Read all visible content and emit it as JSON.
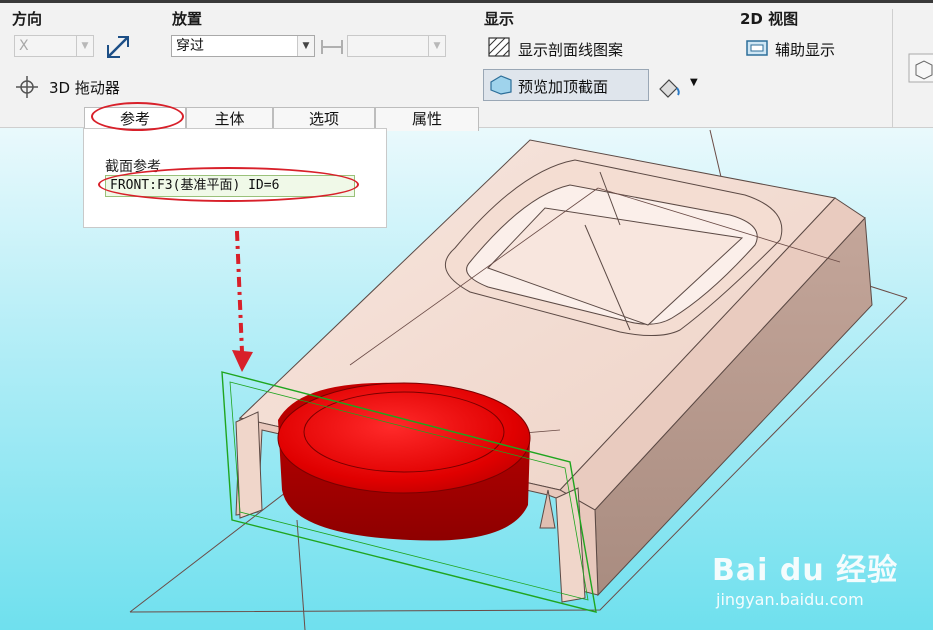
{
  "ribbon": {
    "direction": {
      "title": "方向",
      "axis_value": "X",
      "dragger_label": "3D 拖动器"
    },
    "placement": {
      "title": "放置",
      "mode_value": "穿过",
      "offset_value": ""
    },
    "display": {
      "title": "显示",
      "hatch_label": "显示剖面线图案",
      "preview_cap_label": "预览加顶截面"
    },
    "view2d": {
      "title": "2D 视图",
      "aux_label": "辅助显示"
    }
  },
  "tabs": [
    {
      "label": "参考",
      "active": true
    },
    {
      "label": "主体",
      "active": false
    },
    {
      "label": "选项",
      "active": false
    },
    {
      "label": "属性",
      "active": false
    }
  ],
  "reference_panel": {
    "title": "截面参考",
    "reference_value": "FRONT:F3(基准平面) ID=6"
  },
  "watermark": {
    "brand": "Bai du 经验",
    "url": "jingyan.baidu.com"
  },
  "colors": {
    "part_body": "#f2d8cc",
    "part_side": "#c9aa9e",
    "cap_section": "#e60000",
    "annotation": "#d8202a",
    "plane_outline": "#1fa51f"
  }
}
